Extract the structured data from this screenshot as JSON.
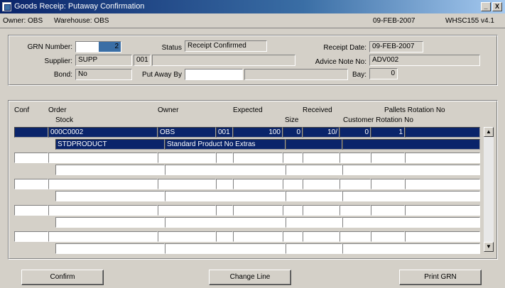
{
  "window": {
    "title": "Goods Receip: Putaway Confirmation",
    "minimize_label": "_",
    "close_label": "X"
  },
  "infobar": {
    "owner_text": "Owner: OBS",
    "warehouse_text": "Warehouse: OBS",
    "date": "09-FEB-2007",
    "version": "WHSC155 v4.1"
  },
  "header": {
    "grn_label": "GRN Number:",
    "grn_value": "2",
    "status_label": "Status",
    "status_value": "Receipt Confirmed",
    "receipt_date_label": "Receipt Date:",
    "receipt_date_value": "09-FEB-2007",
    "supplier_label": "Supplier:",
    "supplier_code": "SUPP",
    "supplier_seq": "001",
    "supplier_name": "",
    "advice_note_label": "Advice Note No:",
    "advice_note_value": "ADV002",
    "bond_label": "Bond:",
    "bond_value": "No",
    "putaway_label": "Put Away By",
    "putaway_code": "",
    "putaway_name": "",
    "bay_label": "Bay:",
    "bay_value": "0"
  },
  "grid": {
    "headers_row1": {
      "conf": "Conf",
      "order": "Order",
      "owner": "Owner",
      "expected": "Expected",
      "received": "Received",
      "pallets_rotation": "Pallets Rotation No"
    },
    "headers_row2": {
      "stock": "Stock",
      "size": "Size",
      "customer_rotation": "Customer Rotation No"
    },
    "rows": [
      {
        "conf": "",
        "order": "000C0002",
        "owner": "OBS",
        "line": "001",
        "expected": "100",
        "expected_suffix": "0",
        "received": "10/",
        "received_suffix": "0",
        "pallets": "1",
        "rotation": "",
        "stock": "STDPRODUCT",
        "description": "Standard Product No Extras",
        "size": "",
        "customer_rotation": ""
      }
    ],
    "empty_row_count": 4
  },
  "scrollbar": {
    "up_label": "▲",
    "down_label": "▼"
  },
  "buttons": {
    "confirm": "Confirm",
    "change_line": "Change Line",
    "print_grn": "Print GRN"
  },
  "colors": {
    "selection": "#0a246a",
    "face": "#d4d0c8"
  }
}
